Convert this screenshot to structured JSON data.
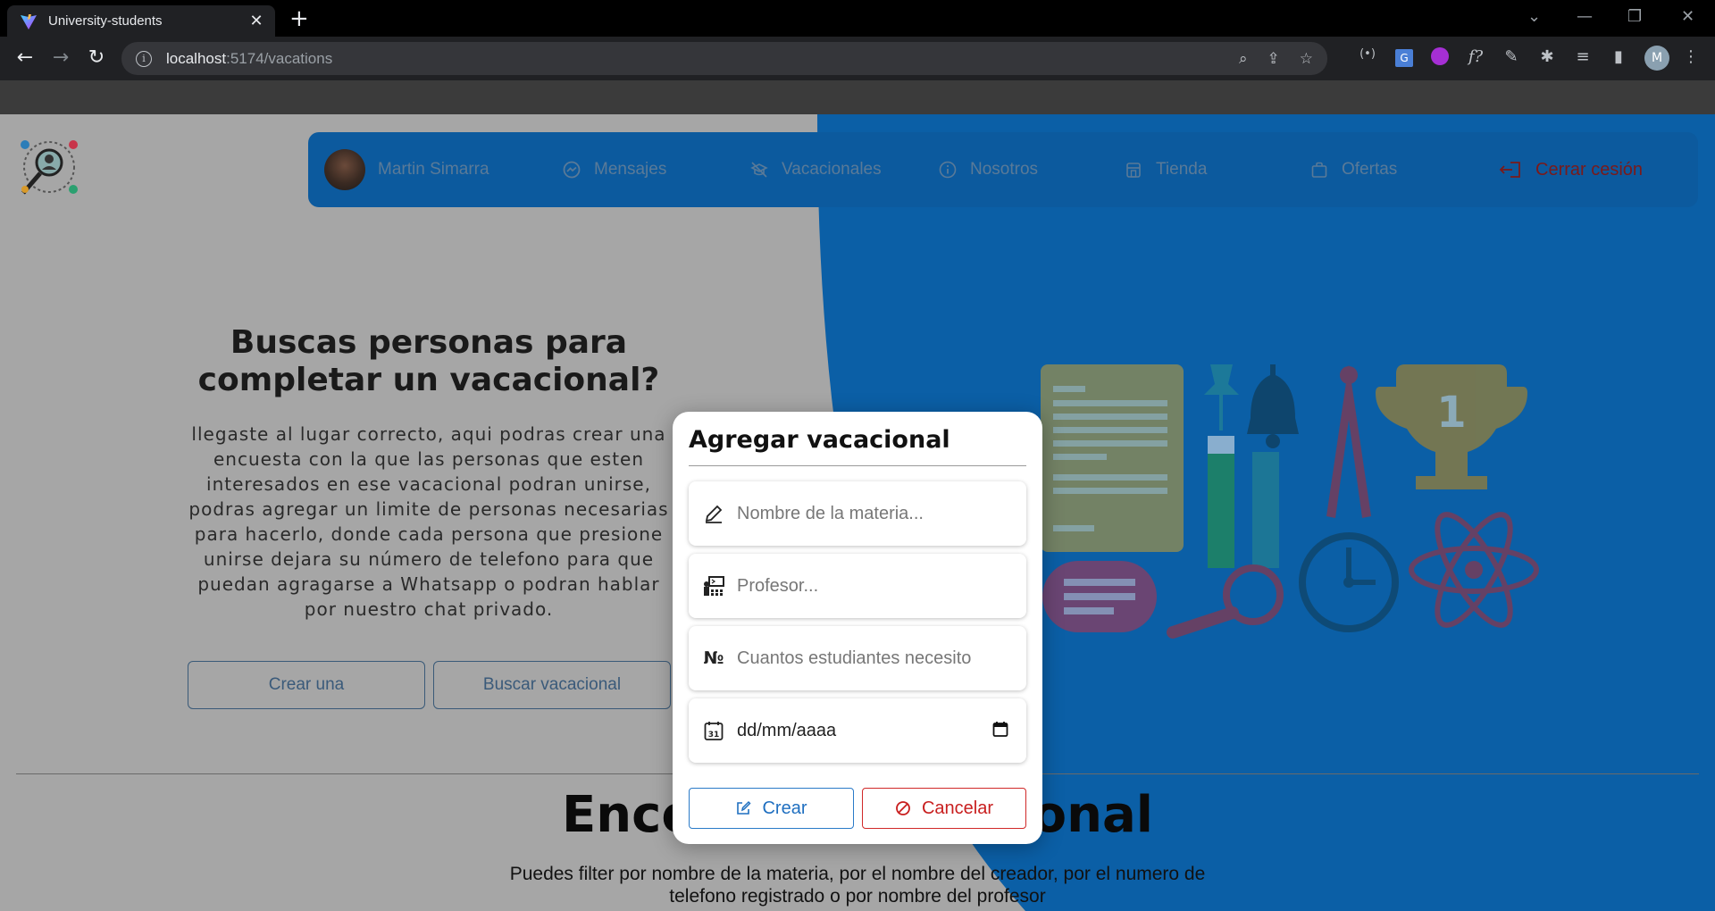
{
  "browser": {
    "tab_title": "University-students",
    "url_host": "localhost",
    "url_path": ":5174/vacations",
    "profile_initial": "M"
  },
  "nav": {
    "user_name": "Martin Simarra",
    "items": [
      {
        "label": "Mensajes",
        "icon": "messenger-icon"
      },
      {
        "label": "Vacacionales",
        "icon": "no-school-icon"
      },
      {
        "label": "Nosotros",
        "icon": "info-icon"
      },
      {
        "label": "Tienda",
        "icon": "store-icon"
      },
      {
        "label": "Ofertas",
        "icon": "bag-icon"
      }
    ],
    "logout_label": "Cerrar cesión"
  },
  "hero": {
    "title": "Buscas personas para completar un vacacional?",
    "text": "llegaste al lugar correcto, aqui podras crear una encuesta con la que las personas que esten interesados en ese vacacional podran unirse, podras agregar un limite de personas necesarias para hacerlo, donde cada persona que presione unirse dejara su número de telefono para que puedan agragarse a Whatsapp o podran hablar por nuestro chat privado.",
    "create_button": "Crear una",
    "search_button": "Buscar vacacional"
  },
  "section": {
    "title": "Encontrar vacacional",
    "text": "Puedes filter por nombre de la materia, por el nombre del creador, por el numero de telefono registrado o por nombre del profesor"
  },
  "modal": {
    "title": "Agregar vacacional",
    "subject_placeholder": "Nombre de la materia...",
    "teacher_placeholder": "Profesor...",
    "students_placeholder": "Cuantos estudiantes necesito",
    "date_value": "dd/mm/aaaa",
    "create_button": "Crear",
    "cancel_button": "Cancelar"
  },
  "colors": {
    "nav_bg": "#0c5a9e",
    "page_blue": "#0b5fa6",
    "create_accent": "#1f6fc0",
    "cancel_accent": "#c81e1e"
  }
}
